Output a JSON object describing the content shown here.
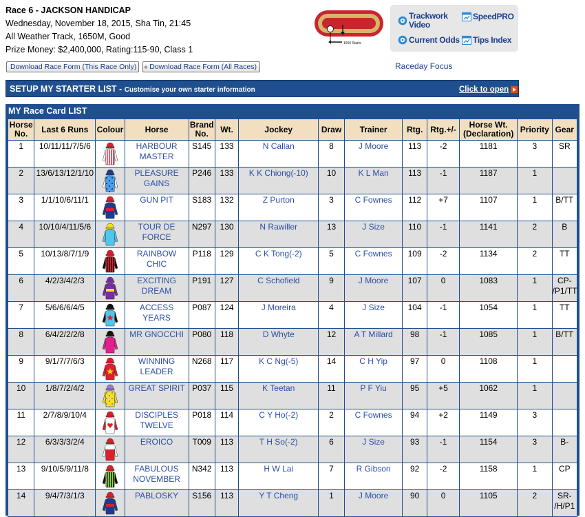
{
  "race": {
    "title": "Race 6 - JACKSON HANDICAP",
    "datetime": "Wednesday, November 18, 2015, Sha Tin, 21:45",
    "track": "All Weather Track, 1650M, Good",
    "prize": "Prize Money: $2,400,000, Rating:115-90, Class 1"
  },
  "downloads": {
    "this_race": "Download Race Form (This Race Only)",
    "all_races": "Download Race Form (All Races)"
  },
  "track_map": {
    "label": "1650 Starts"
  },
  "quick_links": {
    "trackwork_line1": "Trackwork",
    "trackwork_line2": "Video",
    "speedpro": "SpeedPRO",
    "current_odds": "Current Odds",
    "tips_index": "Tips Index"
  },
  "raceday_focus": "Raceday Focus",
  "setup": {
    "title": "SETUP MY STARTER LIST - ",
    "subtitle": "Customise your own starter information",
    "open_link": "Click to open"
  },
  "card": {
    "title": "MY Race Card LIST",
    "headers": {
      "no1": "Horse",
      "no2": "No.",
      "last6": "Last 6 Runs",
      "colour": "Colour",
      "horse": "Horse",
      "brand1": "Brand",
      "brand2": "No.",
      "wt": "Wt.",
      "jockey": "Jockey",
      "draw": "Draw",
      "trainer": "Trainer",
      "rtg": "Rtg.",
      "rtgchg": "Rtg.+/-",
      "hw1": "Horse Wt.",
      "hw2": "(Declaration)",
      "priority": "Priority",
      "gear": "Gear"
    },
    "rows": [
      {
        "no": "1",
        "last6": "10/11/11/7/5/6",
        "h1": "HARBOUR",
        "h2": "MASTER",
        "brand": "S145",
        "wt": "133",
        "jockey": "N Callan",
        "draw": "8",
        "trainer": "J Moore",
        "rtg": "113",
        "chg": "-2",
        "hwt": "1181",
        "pri": "3",
        "g1": "SR",
        "g2": "",
        "silk": {
          "body": "#ffffff",
          "stripes": "#e01e2c",
          "sleeves": "#ffffff",
          "cap": "#e01e2c",
          "pattern": "vstripe"
        }
      },
      {
        "no": "2",
        "last6": "13/6/13/12/1/10",
        "h1": "PLEASURE",
        "h2": "GAINS",
        "brand": "P246",
        "wt": "133",
        "jockey": "K K Chiong(-10)",
        "draw": "10",
        "trainer": "K L Man",
        "rtg": "113",
        "chg": "-1",
        "hwt": "1187",
        "pri": "1",
        "g1": "",
        "g2": "",
        "silk": {
          "body": "#4aa0e8",
          "stripes": "#1b3d8f",
          "sleeves": "#ffffff",
          "cap": "#1b3d8f",
          "pattern": "check"
        }
      },
      {
        "no": "3",
        "last6": "1/1/10/6/11/1",
        "h1": "GUN PIT",
        "h2": "",
        "brand": "S183",
        "wt": "132",
        "jockey": "Z Purton",
        "draw": "3",
        "trainer": "C Fownes",
        "rtg": "112",
        "chg": "+7",
        "hwt": "1107",
        "pri": "1",
        "g1": "B/TT",
        "g2": "",
        "silk": {
          "body": "#1b3d8f",
          "stripes": "#e01e2c",
          "sleeves": "#1b3d8f",
          "cap": "#e01e2c",
          "pattern": "band"
        }
      },
      {
        "no": "4",
        "last6": "10/10/4/11/5/6",
        "h1": "TOUR DE",
        "h2": "FORCE",
        "brand": "N297",
        "wt": "130",
        "jockey": "N Rawiller",
        "draw": "13",
        "trainer": "J Size",
        "rtg": "110",
        "chg": "-1",
        "hwt": "1141",
        "pri": "2",
        "g1": "B",
        "g2": "",
        "silk": {
          "body": "#4fc6ee",
          "stripes": "#4fc6ee",
          "sleeves": "#4fc6ee",
          "cap": "#f4e21c",
          "pattern": "plain"
        }
      },
      {
        "no": "5",
        "last6": "10/13/8/7/1/9",
        "h1": "RAINBOW",
        "h2": "CHIC",
        "brand": "P118",
        "wt": "129",
        "jockey": "C K Tong(-2)",
        "draw": "5",
        "trainer": "C Fownes",
        "rtg": "109",
        "chg": "-2",
        "hwt": "1134",
        "pri": "2",
        "g1": "TT",
        "g2": "",
        "silk": {
          "body": "#e01e2c",
          "stripes": "#111111",
          "sleeves": "#111111",
          "cap": "#e01e2c",
          "pattern": "vstripe"
        }
      },
      {
        "no": "6",
        "last6": "4/2/3/4/2/3",
        "h1": "EXCITING",
        "h2": "DREAM",
        "brand": "P191",
        "wt": "127",
        "jockey": "C Schofield",
        "draw": "9",
        "trainer": "J Moore",
        "rtg": "107",
        "chg": "0",
        "hwt": "1083",
        "pri": "1",
        "g1": "CP-",
        "g2": "/P1/TT",
        "silk": {
          "body": "#7a2ca0",
          "stripes": "#f4e21c",
          "sleeves": "#7a2ca0",
          "cap": "#7a2ca0",
          "pattern": "band"
        }
      },
      {
        "no": "7",
        "last6": "5/6/6/6/4/5",
        "h1": "ACCESS",
        "h2": "YEARS",
        "brand": "P087",
        "wt": "124",
        "jockey": "J Moreira",
        "draw": "4",
        "trainer": "J Size",
        "rtg": "104",
        "chg": "-1",
        "hwt": "1054",
        "pri": "1",
        "g1": "TT",
        "g2": "",
        "silk": {
          "body": "#4fc6ee",
          "stripes": "#e01e2c",
          "sleeves": "#111111",
          "cap": "#111111",
          "pattern": "star"
        }
      },
      {
        "no": "8",
        "last6": "6/4/2/2/2/8",
        "h1": "MR GNOCCHI",
        "h2": "",
        "brand": "P080",
        "wt": "118",
        "jockey": "D Whyte",
        "draw": "12",
        "trainer": "A T Millard",
        "rtg": "98",
        "chg": "-1",
        "hwt": "1085",
        "pri": "1",
        "g1": "B/TT",
        "g2": "",
        "silk": {
          "body": "#e0208c",
          "stripes": "#e0208c",
          "sleeves": "#e0208c",
          "cap": "#111111",
          "pattern": "plain"
        }
      },
      {
        "no": "9",
        "last6": "9/1/7/7/6/3",
        "h1": "WINNING",
        "h2": "LEADER",
        "brand": "N268",
        "wt": "117",
        "jockey": "K C Ng(-5)",
        "draw": "14",
        "trainer": "C H Yip",
        "rtg": "97",
        "chg": "0",
        "hwt": "1108",
        "pri": "1",
        "g1": "",
        "g2": "",
        "silk": {
          "body": "#e01e2c",
          "stripes": "#f4e21c",
          "sleeves": "#e01e2c",
          "cap": "#e01e2c",
          "pattern": "star"
        }
      },
      {
        "no": "10",
        "last6": "1/8/7/2/4/2",
        "h1": "GREAT SPIRIT",
        "h2": "",
        "brand": "P037",
        "wt": "115",
        "jockey": "K Teetan",
        "draw": "11",
        "trainer": "P F Yiu",
        "rtg": "95",
        "chg": "+5",
        "hwt": "1062",
        "pri": "1",
        "g1": "",
        "g2": "",
        "silk": {
          "body": "#f4e21c",
          "stripes": "#9a7ad8",
          "sleeves": "#f4e21c",
          "cap": "#9a7ad8",
          "pattern": "check"
        }
      },
      {
        "no": "11",
        "last6": "2/7/8/9/10/4",
        "h1": "DISCIPLES",
        "h2": "TWELVE",
        "brand": "P018",
        "wt": "114",
        "jockey": "C Y Ho(-2)",
        "draw": "2",
        "trainer": "C Fownes",
        "rtg": "94",
        "chg": "+2",
        "hwt": "1149",
        "pri": "3",
        "g1": "",
        "g2": "",
        "silk": {
          "body": "#ffffff",
          "stripes": "#e01e2c",
          "sleeves": "#e01e2c",
          "cap": "#e01e2c",
          "pattern": "heart"
        }
      },
      {
        "no": "12",
        "last6": "6/3/3/3/2/4",
        "h1": "EROICO",
        "h2": "",
        "brand": "T009",
        "wt": "113",
        "jockey": "T H So(-2)",
        "draw": "6",
        "trainer": "J Size",
        "rtg": "93",
        "chg": "-1",
        "hwt": "1154",
        "pri": "3",
        "g1": "B-",
        "g2": "",
        "silk": {
          "body": "#e01e2c",
          "stripes": "#ffffff",
          "sleeves": "#ffffff",
          "cap": "#e01e2c",
          "pattern": "yoke"
        }
      },
      {
        "no": "13",
        "last6": "9/10/5/9/11/8",
        "h1": "FABULOUS",
        "h2": "NOVEMBER",
        "brand": "N342",
        "wt": "113",
        "jockey": "H W Lai",
        "draw": "7",
        "trainer": "R Gibson",
        "rtg": "92",
        "chg": "-2",
        "hwt": "1158",
        "pri": "1",
        "g1": "CP",
        "g2": "",
        "silk": {
          "body": "#8ee04a",
          "stripes": "#111111",
          "sleeves": "#111111",
          "cap": "#e01e2c",
          "pattern": "vstripe"
        }
      },
      {
        "no": "14",
        "last6": "9/4/7/3/1/3",
        "h1": "PABLOSKY",
        "h2": "",
        "brand": "S156",
        "wt": "113",
        "jockey": "Y T Cheng",
        "draw": "1",
        "trainer": "J Moore",
        "rtg": "90",
        "chg": "0",
        "hwt": "1105",
        "pri": "2",
        "g1": "SR-",
        "g2": "/H/P1",
        "silk": {
          "body": "#1b3d8f",
          "stripes": "#e01e2c",
          "sleeves": "#1b3d8f",
          "cap": "#e01e2c",
          "pattern": "band"
        }
      }
    ]
  }
}
